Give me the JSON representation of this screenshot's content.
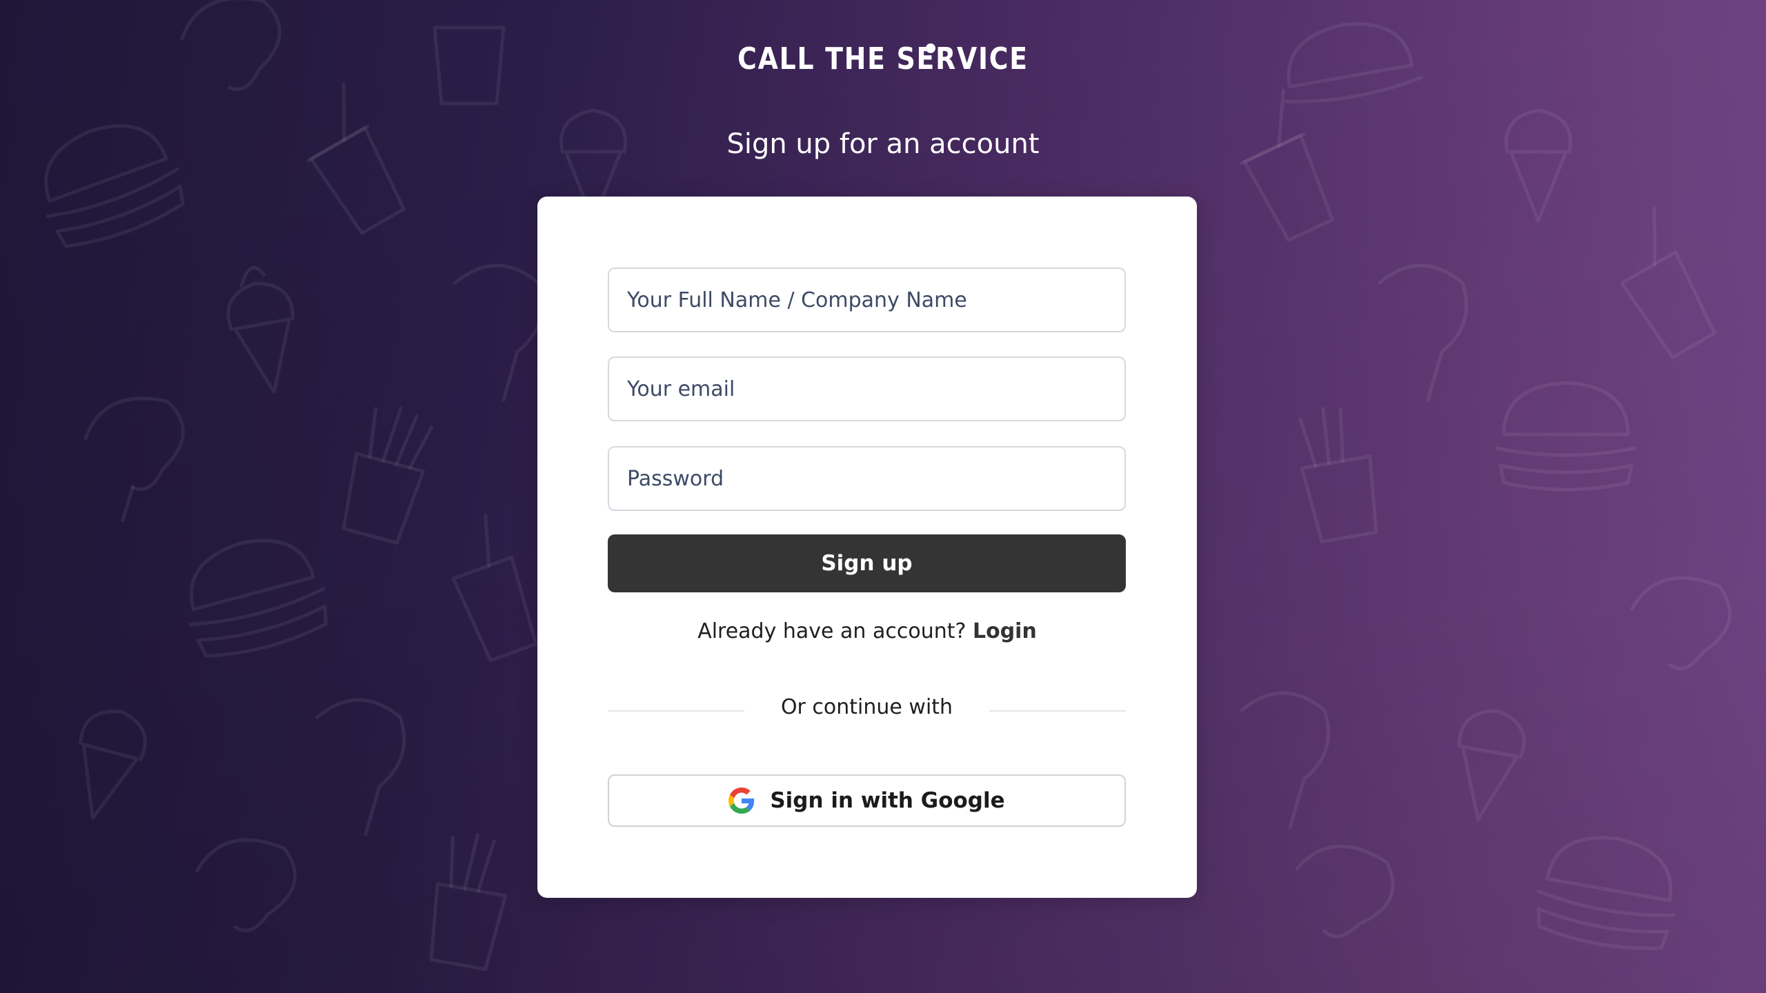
{
  "brand": {
    "logo_text": "CALL THE SERVICE"
  },
  "page": {
    "title": "Sign up for an account"
  },
  "form": {
    "name_placeholder": "Your Full Name / Company Name",
    "email_placeholder": "Your email",
    "password_placeholder": "Password",
    "name_value": "",
    "email_value": "",
    "password_value": "",
    "submit_label": "Sign up"
  },
  "login_prompt": {
    "text": "Already have an account?",
    "link_label": "Login"
  },
  "divider": {
    "text": "Or continue with"
  },
  "social": {
    "google_label": "Sign in with Google",
    "google_icon": "google-g-icon"
  },
  "colors": {
    "bg_left": "#1f1738",
    "bg_right": "#76478a",
    "primary_button": "#343434",
    "card": "#ffffff"
  }
}
